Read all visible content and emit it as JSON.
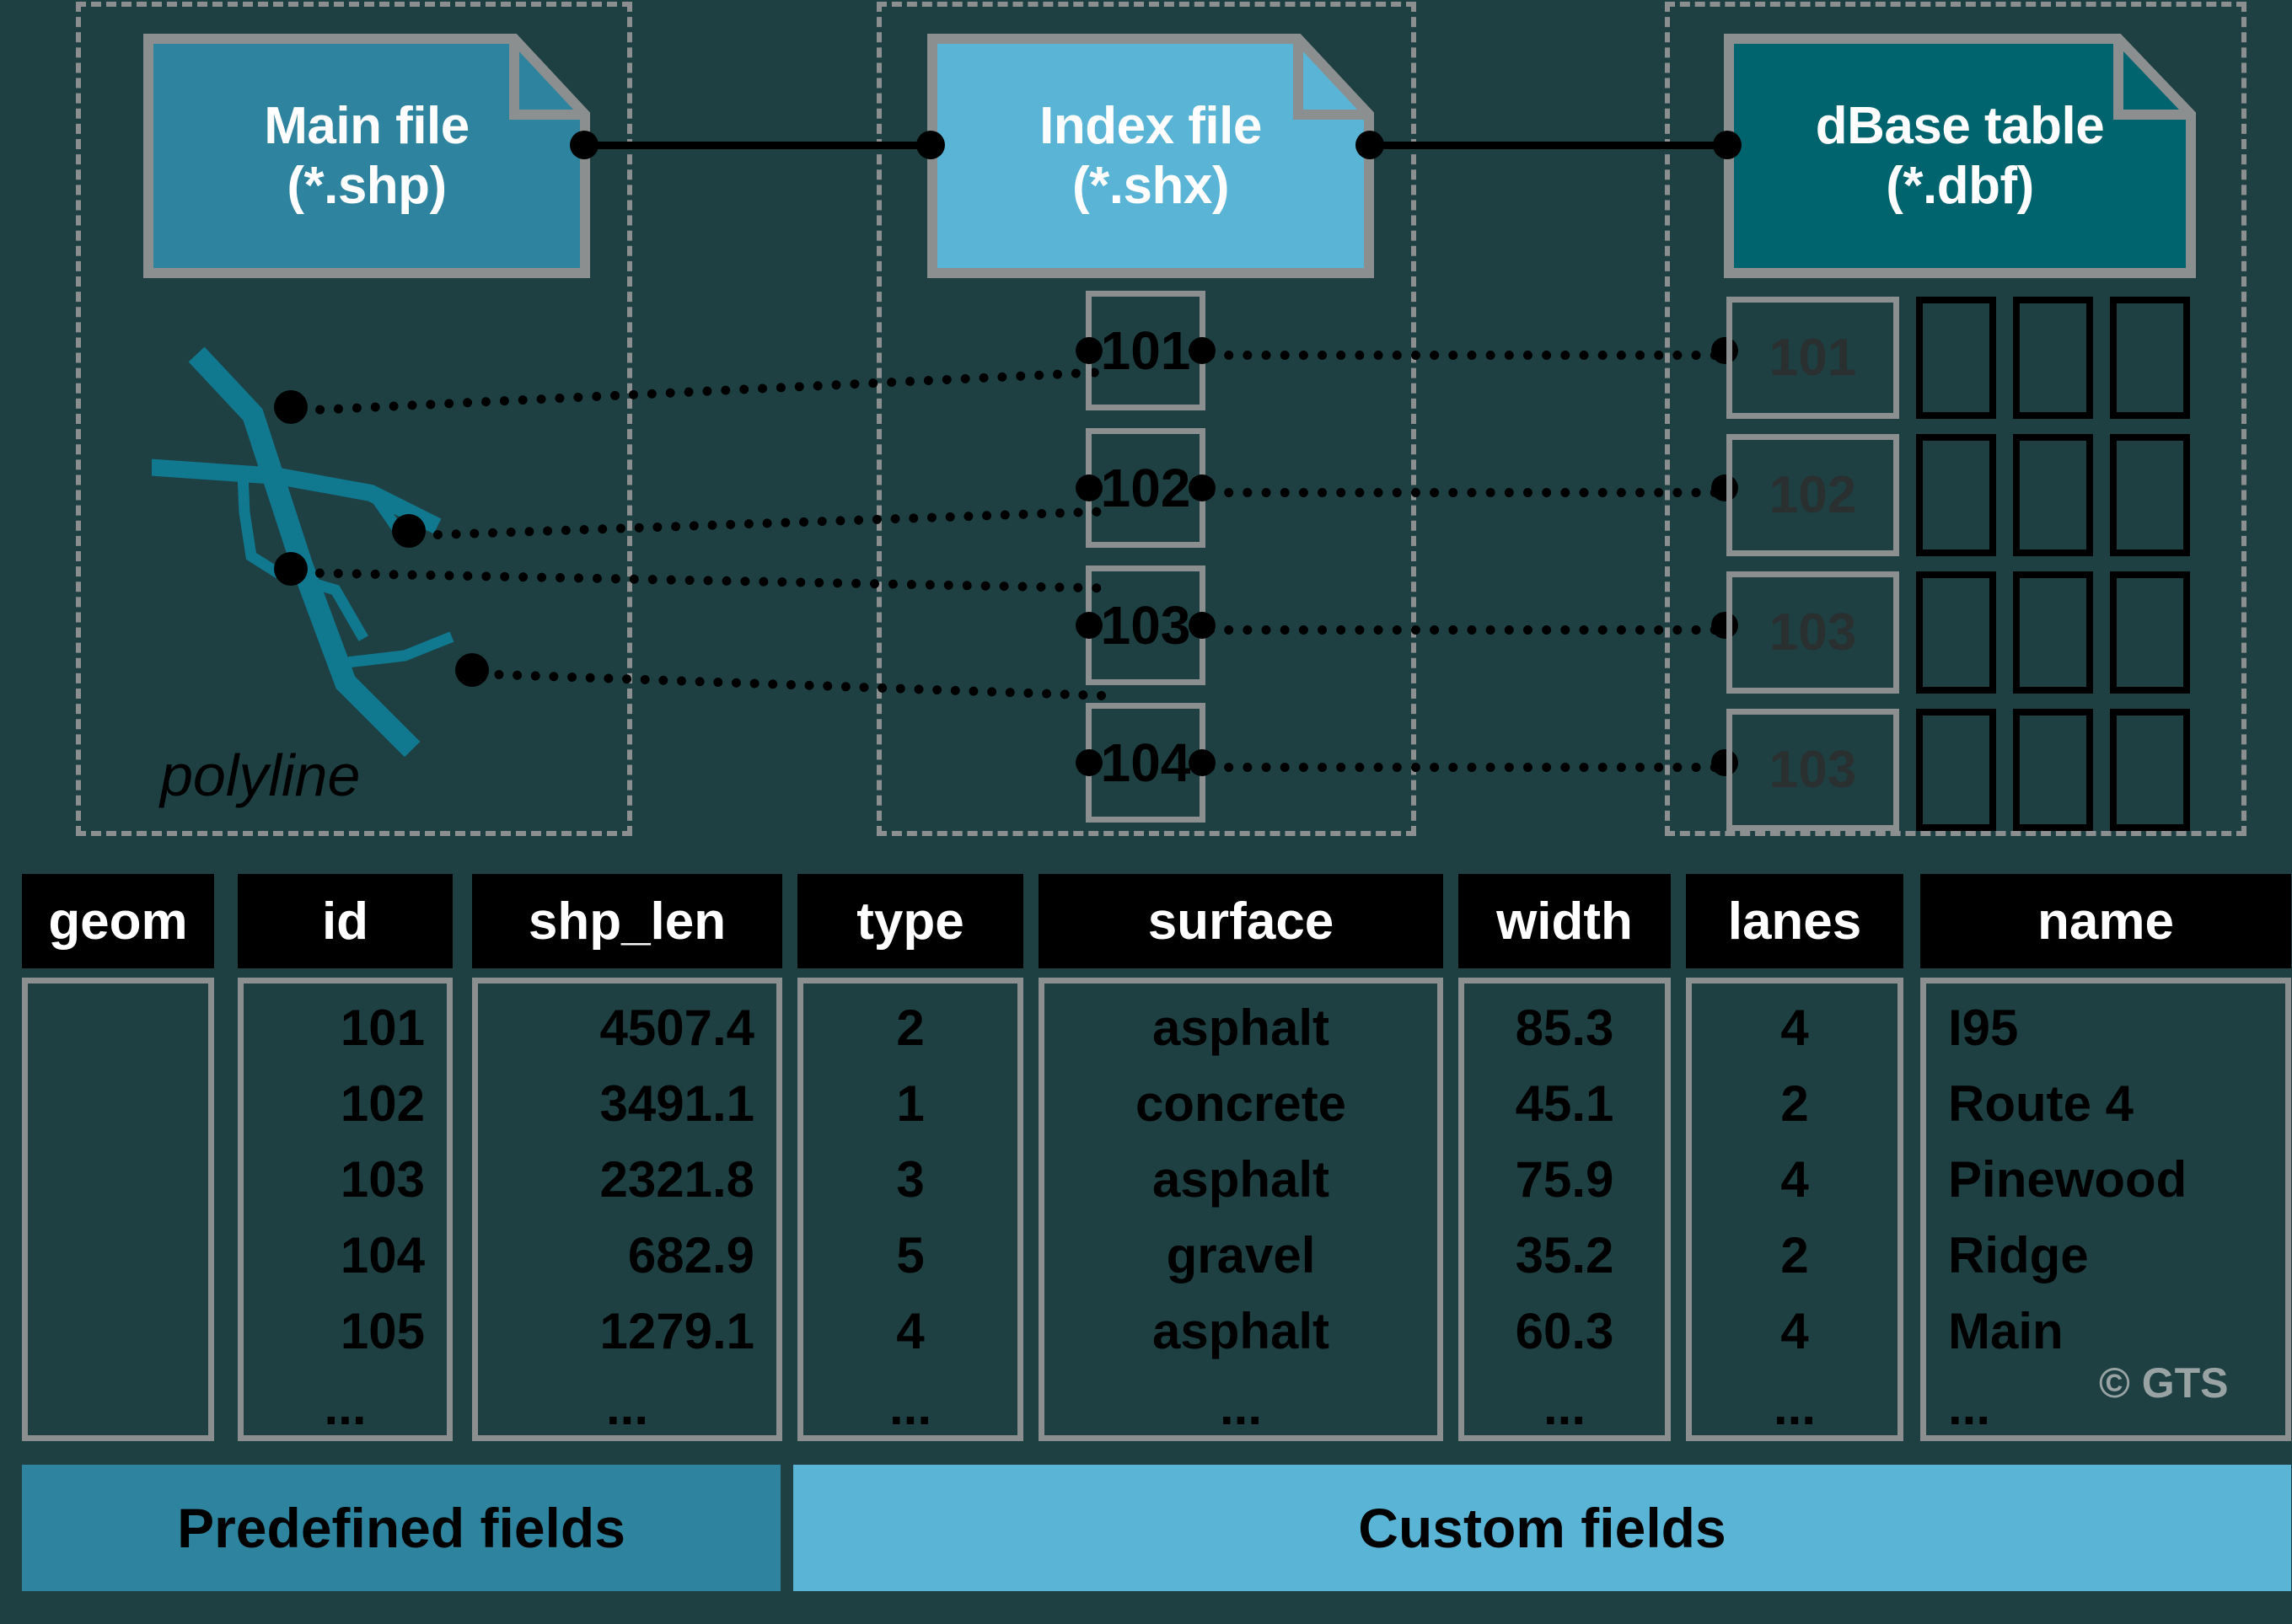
{
  "background_color": "#1e4043",
  "files": [
    {
      "title": "Main file",
      "ext": "(*.shp)",
      "color": "#2e839e",
      "name": "main-file"
    },
    {
      "title": "Index file",
      "ext": "(*.shx)",
      "color": "#5ab4d6",
      "name": "index-file"
    },
    {
      "title": "dBase table",
      "ext": "(*.dbf)",
      "color": "#00646f",
      "name": "dbase-table"
    }
  ],
  "geometry_label": "polyline",
  "index_records": [
    "101",
    "102",
    "103",
    "104"
  ],
  "dbase_records": [
    "101",
    "102",
    "103",
    "103"
  ],
  "attribute_table": {
    "columns": [
      {
        "header": "geom",
        "align": "center",
        "values": []
      },
      {
        "header": "id",
        "align": "right",
        "values": [
          "101",
          "102",
          "103",
          "104",
          "105",
          "..."
        ]
      },
      {
        "header": "shp_len",
        "align": "right",
        "values": [
          "4507.4",
          "3491.1",
          "2321.8",
          "682.9",
          "1279.1",
          "..."
        ]
      },
      {
        "header": "type",
        "align": "center",
        "values": [
          "2",
          "1",
          "3",
          "5",
          "4",
          "..."
        ]
      },
      {
        "header": "surface",
        "align": "center",
        "values": [
          "asphalt",
          "concrete",
          "asphalt",
          "gravel",
          "asphalt",
          "..."
        ]
      },
      {
        "header": "width",
        "align": "center",
        "values": [
          "85.3",
          "45.1",
          "75.9",
          "35.2",
          "60.3",
          "..."
        ]
      },
      {
        "header": "lanes",
        "align": "center",
        "values": [
          "4",
          "2",
          "4",
          "2",
          "4",
          "..."
        ]
      },
      {
        "header": "name",
        "align": "left",
        "values": [
          "I95",
          "Route 4",
          "Pinewood",
          "Ridge",
          "Main",
          "..."
        ]
      }
    ]
  },
  "legend": {
    "predefined": {
      "label": "Predefined fields",
      "color": "#2e839e"
    },
    "custom": {
      "label": "Custom fields",
      "color": "#5ab4d6"
    }
  },
  "credit": "© GTS",
  "colors": {
    "dashed_border": "#8b8f90",
    "polyline": "#10788f",
    "link": "#000000",
    "header_bg": "#000000",
    "header_text": "#ffffff"
  }
}
